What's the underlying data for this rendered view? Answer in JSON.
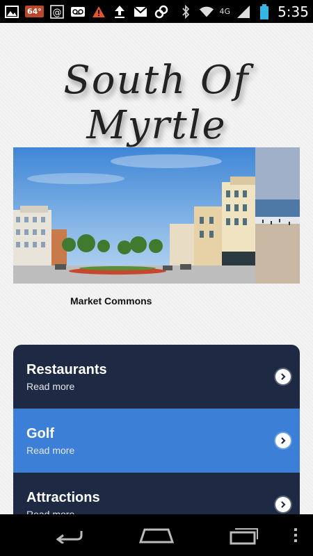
{
  "status_bar": {
    "left_icons": [
      "image-icon",
      "temperature-icon",
      "at-icon",
      "voicemail-icon",
      "warning-icon",
      "upload-icon",
      "mail-icon",
      "link-icon"
    ],
    "temperature": "64°",
    "right_icons": [
      "bluetooth-icon",
      "wifi-icon",
      "signal-icon",
      "battery-icon"
    ],
    "network_label": "4G",
    "time": "5:35"
  },
  "header": {
    "logo_text": "South Of Myrtle"
  },
  "hero": {
    "caption": "Market Commons"
  },
  "menu": {
    "items": [
      {
        "title": "Restaurants",
        "subtitle": "Read more",
        "style": "dark"
      },
      {
        "title": "Golf",
        "subtitle": "Read more",
        "style": "light"
      },
      {
        "title": "Attractions",
        "subtitle": "Read more",
        "style": "dark"
      }
    ]
  },
  "colors": {
    "menu_dark": "#1e2a44",
    "menu_light": "#3b7fd7",
    "battery": "#33b5e5"
  },
  "nav_bar": {
    "buttons": [
      "back-icon",
      "home-icon",
      "recent-apps-icon",
      "overflow-menu-icon"
    ]
  }
}
